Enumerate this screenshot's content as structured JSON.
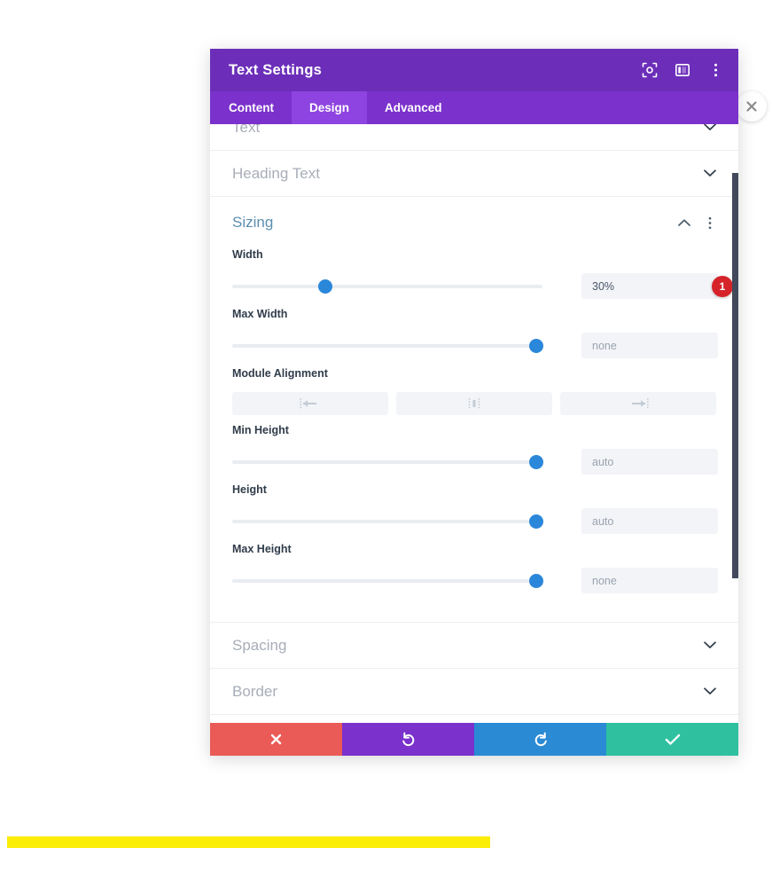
{
  "header": {
    "title": "Text Settings",
    "icons": [
      {
        "name": "focus-icon",
        "label": "Focus"
      },
      {
        "name": "layout-panel-icon",
        "label": "Panel Layout"
      },
      {
        "name": "more-vertical-icon",
        "label": "More Options"
      }
    ]
  },
  "tabs": [
    {
      "label": "Content",
      "active": false
    },
    {
      "label": "Design",
      "active": true
    },
    {
      "label": "Advanced",
      "active": false
    }
  ],
  "sections": {
    "text": {
      "label": "Text",
      "state": "collapsed"
    },
    "heading_text": {
      "label": "Heading Text",
      "state": "collapsed"
    },
    "sizing": {
      "label": "Sizing",
      "state": "expanded"
    },
    "spacing": {
      "label": "Spacing",
      "state": "collapsed"
    },
    "border": {
      "label": "Border",
      "state": "collapsed"
    }
  },
  "sizing_fields": {
    "width": {
      "label": "Width",
      "value": "30%",
      "is_placeholder": false,
      "slider_percent": 30,
      "badge": "1"
    },
    "max_width": {
      "label": "Max Width",
      "value": "none",
      "is_placeholder": true,
      "slider_percent": 98
    },
    "module_alignment": {
      "label": "Module Alignment",
      "options": [
        {
          "name": "align-left-icon",
          "label": "Align Left"
        },
        {
          "name": "align-center-icon",
          "label": "Align Center"
        },
        {
          "name": "align-right-icon",
          "label": "Align Right"
        }
      ]
    },
    "min_height": {
      "label": "Min Height",
      "value": "auto",
      "is_placeholder": true,
      "slider_percent": 98
    },
    "height": {
      "label": "Height",
      "value": "auto",
      "is_placeholder": true,
      "slider_percent": 98
    },
    "max_height": {
      "label": "Max Height",
      "value": "none",
      "is_placeholder": true,
      "slider_percent": 98
    }
  },
  "footer": {
    "cancel": {
      "name": "cancel-button",
      "icon": "close-x-icon",
      "color": "#ea5a57"
    },
    "undo": {
      "name": "undo-button",
      "icon": "undo-arrow-icon",
      "color": "#7b31cc"
    },
    "redo": {
      "name": "redo-button",
      "icon": "redo-arrow-icon",
      "color": "#2a8ad4"
    },
    "save": {
      "name": "save-button",
      "icon": "checkmark-icon",
      "color": "#2fc0a0"
    }
  },
  "close_button": {
    "name": "close-panel-button",
    "icon": "close-x-icon"
  },
  "scrollbar": {
    "thumb_color": "#41495a"
  },
  "highlight_bar": {
    "color": "#fbed06"
  },
  "colors": {
    "header_purple": "#6c2eb9",
    "tab_bar_purple": "#7b31cc",
    "tab_active_purple": "#8e44e0",
    "slider_blue": "#2b87da",
    "section_title_blue": "#5b8fb0",
    "badge_red": "#d6232a"
  }
}
